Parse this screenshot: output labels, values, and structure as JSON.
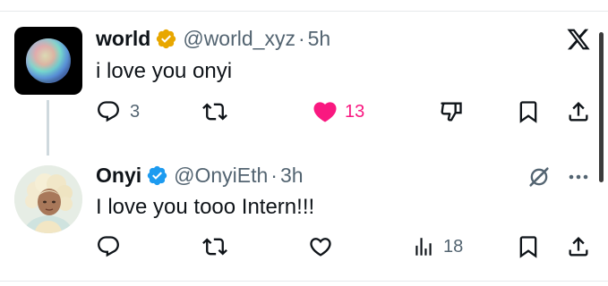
{
  "post1": {
    "author_name": "world",
    "handle": "@world_xyz",
    "separator": "·",
    "time": "5h",
    "text": "i love you onyi",
    "verified": "gold",
    "actions": {
      "replies": "3",
      "reposts": "",
      "likes": "13",
      "liked": true
    }
  },
  "post2": {
    "author_name": "Onyi",
    "handle": "@OnyiEth",
    "separator": "·",
    "time": "3h",
    "text": "I love you tooo Intern!!!",
    "verified": "blue",
    "actions": {
      "replies": "",
      "reposts": "",
      "likes": "",
      "views": "18"
    }
  },
  "colors": {
    "like_active": "#f91880",
    "icon_gray": "#536471",
    "gold_badge": "#e8a700",
    "blue_badge": "#1d9bf0"
  },
  "icons": [
    "x-logo-icon",
    "gold-verified-badge-icon",
    "blue-verified-badge-icon",
    "reply-icon",
    "repost-icon",
    "heart-icon",
    "dislike-icon",
    "bookmark-icon",
    "share-icon",
    "views-icon",
    "grok-icon",
    "more-icon"
  ]
}
